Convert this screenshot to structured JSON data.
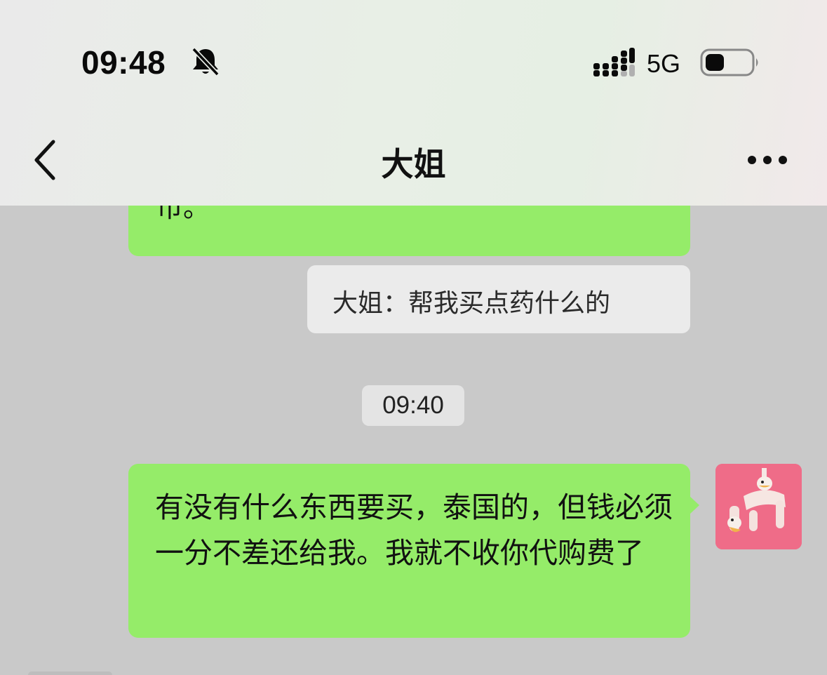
{
  "status_bar": {
    "time": "09:48",
    "network": "5G",
    "icons": [
      "bell-muted-icon",
      "signal-icon",
      "battery-icon"
    ]
  },
  "nav": {
    "title": "大姐",
    "back_icon": "chevron-left-icon",
    "more_icon": "ellipsis-icon"
  },
  "messages": {
    "partial_bubble_text": "币。",
    "quote_text": "大姐：帮我买点药什么的",
    "timestamp": "09:40",
    "main_bubble_text": "有没有什么东西要买，泰国的，但钱必须一分不差还给我。我就不收你代购费了"
  },
  "colors": {
    "bubble_green": "#95ec69",
    "chat_background": "#c9c9c9",
    "avatar_pink": "#ef6c88"
  }
}
